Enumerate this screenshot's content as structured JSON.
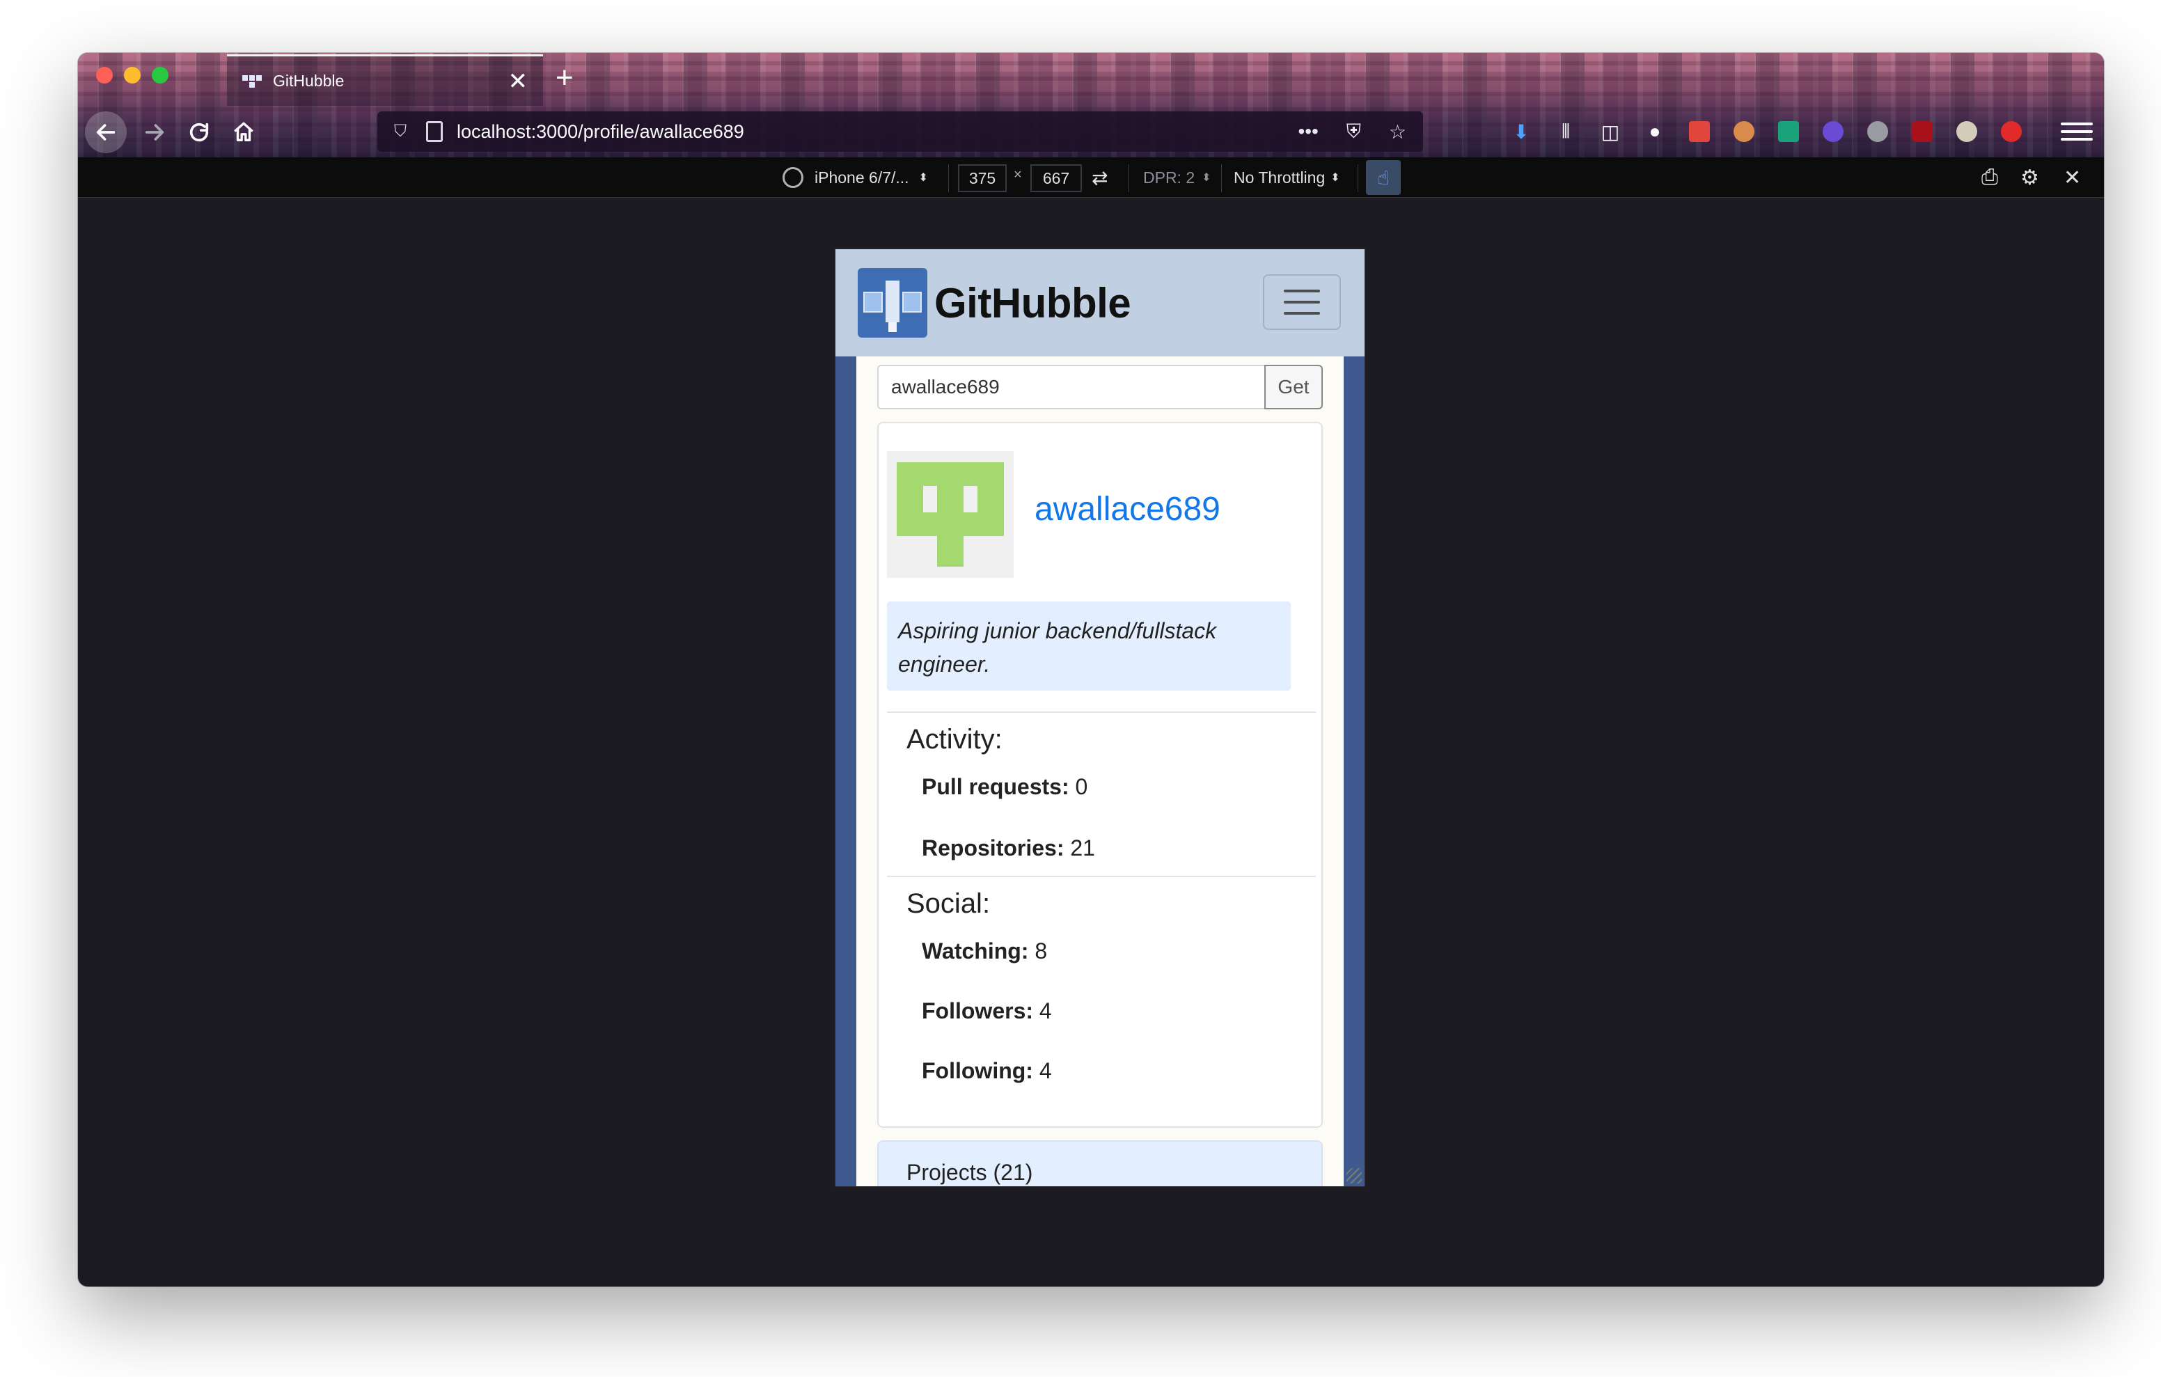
{
  "browser": {
    "tab": {
      "title": "GitHubble",
      "close": "✕"
    },
    "new_tab": "+",
    "url": "localhost:3000/profile/awallace689",
    "more_actions": "•••",
    "icons": [
      "back-arrow-icon",
      "forward-arrow-icon",
      "reload-icon",
      "home-icon",
      "shield-icon",
      "page-icon",
      "pocket-icon",
      "bookmark-star-icon",
      "download-icon",
      "library-icon",
      "sidebar-icon",
      "account-icon",
      "menu-icon"
    ]
  },
  "responsive_toolbar": {
    "device": "iPhone 6/7/...",
    "width": "375",
    "times": "×",
    "height": "667",
    "dpr": "DPR: 2",
    "throttling": "No Throttling"
  },
  "app": {
    "brand": "GitHubble",
    "search": {
      "value": "awallace689",
      "button": "Get"
    },
    "profile": {
      "username": "awallace689",
      "bio": "Aspiring junior backend/fullstack engineer.",
      "activity": {
        "heading": "Activity:",
        "pull_requests_label": "Pull requests:",
        "pull_requests": "0",
        "repositories_label": "Repositories:",
        "repositories": "21"
      },
      "social": {
        "heading": "Social:",
        "watching_label": "Watching:",
        "watching": "8",
        "followers_label": "Followers:",
        "followers": "4",
        "following_label": "Following:",
        "following": "4"
      }
    },
    "projects_label": "Projects (21)"
  },
  "colors": {
    "app_navbar": "#c0d0e2",
    "viewport_background": "#3e5a8e",
    "username_link": "#1377e8",
    "bio_background": "#e3efff",
    "avatar_green": "#a3d96e"
  }
}
